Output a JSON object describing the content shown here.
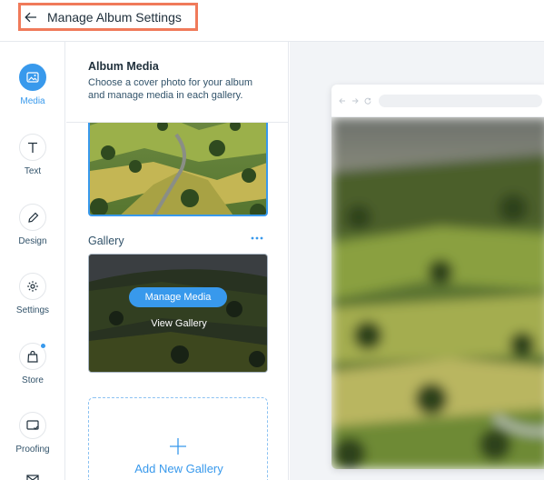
{
  "header": {
    "title": "Manage Album Settings"
  },
  "nav": {
    "items": [
      {
        "label": "Media",
        "icon": "image-icon"
      },
      {
        "label": "Text",
        "icon": "text-icon"
      },
      {
        "label": "Design",
        "icon": "brush-icon"
      },
      {
        "label": "Settings",
        "icon": "gear-icon"
      },
      {
        "label": "Store",
        "icon": "bag-icon"
      },
      {
        "label": "Proofing",
        "icon": "proofing-icon"
      }
    ]
  },
  "panel": {
    "title": "Album Media",
    "description": "Choose a cover photo for your album and manage media in each gallery.",
    "gallery_label": "Gallery",
    "manage_media": "Manage Media",
    "view_gallery": "View Gallery",
    "add_gallery": "Add New Gallery"
  },
  "colors": {
    "accent": "#3899ec",
    "highlight": "#f07a5a"
  }
}
